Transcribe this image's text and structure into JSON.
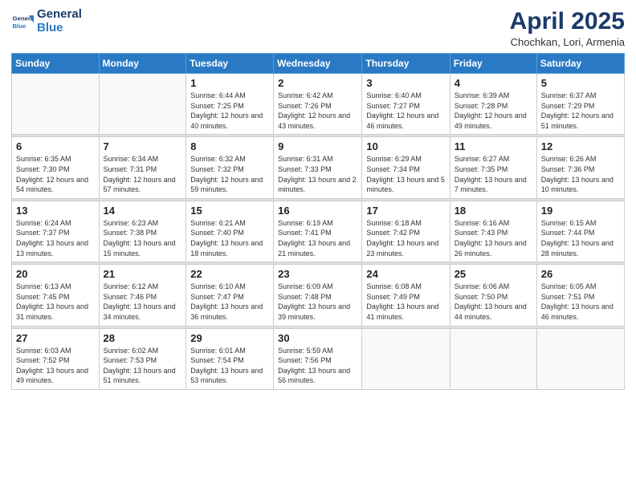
{
  "logo": {
    "line1": "General",
    "line2": "Blue"
  },
  "title": "April 2025",
  "location": "Chochkan, Lori, Armenia",
  "weekdays": [
    "Sunday",
    "Monday",
    "Tuesday",
    "Wednesday",
    "Thursday",
    "Friday",
    "Saturday"
  ],
  "weeks": [
    [
      {
        "day": "",
        "info": ""
      },
      {
        "day": "",
        "info": ""
      },
      {
        "day": "1",
        "info": "Sunrise: 6:44 AM\nSunset: 7:25 PM\nDaylight: 12 hours and 40 minutes."
      },
      {
        "day": "2",
        "info": "Sunrise: 6:42 AM\nSunset: 7:26 PM\nDaylight: 12 hours and 43 minutes."
      },
      {
        "day": "3",
        "info": "Sunrise: 6:40 AM\nSunset: 7:27 PM\nDaylight: 12 hours and 46 minutes."
      },
      {
        "day": "4",
        "info": "Sunrise: 6:39 AM\nSunset: 7:28 PM\nDaylight: 12 hours and 49 minutes."
      },
      {
        "day": "5",
        "info": "Sunrise: 6:37 AM\nSunset: 7:29 PM\nDaylight: 12 hours and 51 minutes."
      }
    ],
    [
      {
        "day": "6",
        "info": "Sunrise: 6:35 AM\nSunset: 7:30 PM\nDaylight: 12 hours and 54 minutes."
      },
      {
        "day": "7",
        "info": "Sunrise: 6:34 AM\nSunset: 7:31 PM\nDaylight: 12 hours and 57 minutes."
      },
      {
        "day": "8",
        "info": "Sunrise: 6:32 AM\nSunset: 7:32 PM\nDaylight: 12 hours and 59 minutes."
      },
      {
        "day": "9",
        "info": "Sunrise: 6:31 AM\nSunset: 7:33 PM\nDaylight: 13 hours and 2 minutes."
      },
      {
        "day": "10",
        "info": "Sunrise: 6:29 AM\nSunset: 7:34 PM\nDaylight: 13 hours and 5 minutes."
      },
      {
        "day": "11",
        "info": "Sunrise: 6:27 AM\nSunset: 7:35 PM\nDaylight: 13 hours and 7 minutes."
      },
      {
        "day": "12",
        "info": "Sunrise: 6:26 AM\nSunset: 7:36 PM\nDaylight: 13 hours and 10 minutes."
      }
    ],
    [
      {
        "day": "13",
        "info": "Sunrise: 6:24 AM\nSunset: 7:37 PM\nDaylight: 13 hours and 13 minutes."
      },
      {
        "day": "14",
        "info": "Sunrise: 6:23 AM\nSunset: 7:38 PM\nDaylight: 13 hours and 15 minutes."
      },
      {
        "day": "15",
        "info": "Sunrise: 6:21 AM\nSunset: 7:40 PM\nDaylight: 13 hours and 18 minutes."
      },
      {
        "day": "16",
        "info": "Sunrise: 6:19 AM\nSunset: 7:41 PM\nDaylight: 13 hours and 21 minutes."
      },
      {
        "day": "17",
        "info": "Sunrise: 6:18 AM\nSunset: 7:42 PM\nDaylight: 13 hours and 23 minutes."
      },
      {
        "day": "18",
        "info": "Sunrise: 6:16 AM\nSunset: 7:43 PM\nDaylight: 13 hours and 26 minutes."
      },
      {
        "day": "19",
        "info": "Sunrise: 6:15 AM\nSunset: 7:44 PM\nDaylight: 13 hours and 28 minutes."
      }
    ],
    [
      {
        "day": "20",
        "info": "Sunrise: 6:13 AM\nSunset: 7:45 PM\nDaylight: 13 hours and 31 minutes."
      },
      {
        "day": "21",
        "info": "Sunrise: 6:12 AM\nSunset: 7:46 PM\nDaylight: 13 hours and 34 minutes."
      },
      {
        "day": "22",
        "info": "Sunrise: 6:10 AM\nSunset: 7:47 PM\nDaylight: 13 hours and 36 minutes."
      },
      {
        "day": "23",
        "info": "Sunrise: 6:09 AM\nSunset: 7:48 PM\nDaylight: 13 hours and 39 minutes."
      },
      {
        "day": "24",
        "info": "Sunrise: 6:08 AM\nSunset: 7:49 PM\nDaylight: 13 hours and 41 minutes."
      },
      {
        "day": "25",
        "info": "Sunrise: 6:06 AM\nSunset: 7:50 PM\nDaylight: 13 hours and 44 minutes."
      },
      {
        "day": "26",
        "info": "Sunrise: 6:05 AM\nSunset: 7:51 PM\nDaylight: 13 hours and 46 minutes."
      }
    ],
    [
      {
        "day": "27",
        "info": "Sunrise: 6:03 AM\nSunset: 7:52 PM\nDaylight: 13 hours and 49 minutes."
      },
      {
        "day": "28",
        "info": "Sunrise: 6:02 AM\nSunset: 7:53 PM\nDaylight: 13 hours and 51 minutes."
      },
      {
        "day": "29",
        "info": "Sunrise: 6:01 AM\nSunset: 7:54 PM\nDaylight: 13 hours and 53 minutes."
      },
      {
        "day": "30",
        "info": "Sunrise: 5:59 AM\nSunset: 7:56 PM\nDaylight: 13 hours and 56 minutes."
      },
      {
        "day": "",
        "info": ""
      },
      {
        "day": "",
        "info": ""
      },
      {
        "day": "",
        "info": ""
      }
    ]
  ]
}
